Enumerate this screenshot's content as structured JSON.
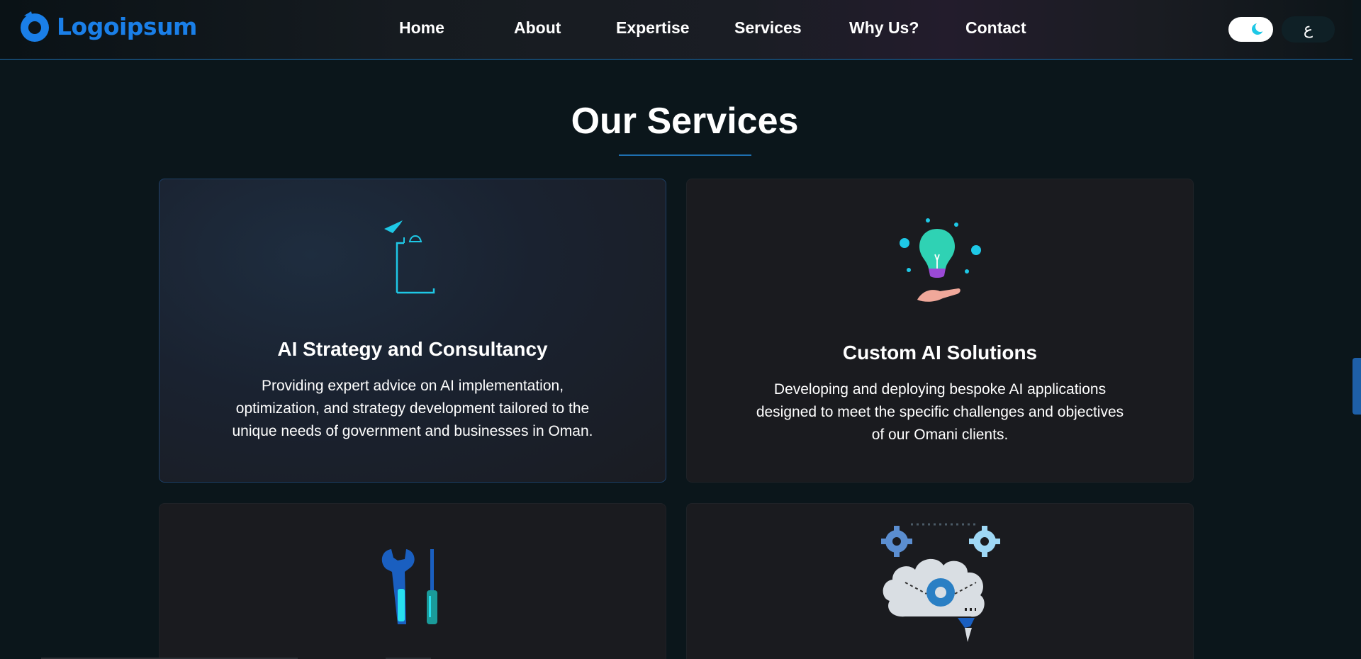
{
  "brand": {
    "name": "Logoipsum",
    "color": "#1a7fe8"
  },
  "nav": {
    "items": [
      "Home",
      "About",
      "Expertise",
      "Services",
      "Why Us?",
      "Contact"
    ]
  },
  "header": {
    "theme_toggle_icon": "moon-icon",
    "language_label": "ع"
  },
  "services": {
    "title": "Our Services",
    "cards": [
      {
        "title": "AI Strategy and Consultancy",
        "description": "Providing expert advice on AI implementation, optimization, and strategy development tailored to the unique needs of government and businesses in Oman.",
        "icon": "strategy-icon"
      },
      {
        "title": "Custom AI Solutions",
        "description": "Developing and deploying bespoke AI applications designed to meet the specific challenges and objectives of our Omani clients.",
        "icon": "lightbulb-hand-icon"
      },
      {
        "title": "",
        "description": "",
        "icon": "tools-icon"
      },
      {
        "title": "",
        "description": "",
        "icon": "brain-gears-icon"
      }
    ]
  },
  "colors": {
    "accent": "#1e6fb0",
    "background": "#0b161b",
    "card": "#1a1b1f"
  }
}
